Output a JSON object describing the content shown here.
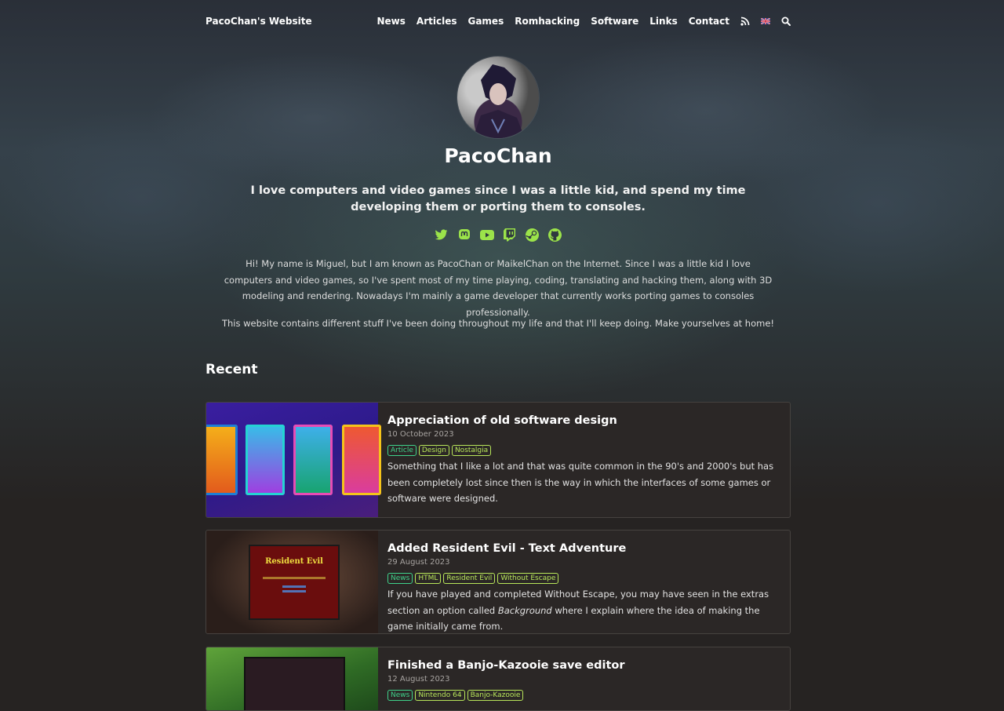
{
  "header": {
    "site_title": "PacoChan's Website",
    "menu": [
      "News",
      "Articles",
      "Games",
      "Romhacking",
      "Software",
      "Links",
      "Contact"
    ],
    "icons": [
      "rss-icon",
      "uk-flag-icon",
      "search-icon"
    ]
  },
  "hero": {
    "name": "PacoChan",
    "tagline": "I love computers and video games since I was a little kid, and spend my time developing them or porting them to consoles.",
    "socials": [
      "twitter-icon",
      "mastodon-icon",
      "youtube-icon",
      "twitch-icon",
      "steam-icon",
      "github-icon"
    ],
    "intro": "Hi! My name is Miguel, but I am known as PacoChan or MaikelChan on the Internet. Since I was a little kid I love computers and video games, so I've spent most of my time playing, coding, translating and hacking them, along with 3D modeling and rendering. Nowadays I'm mainly a game developer that currently works porting games to consoles professionally.",
    "intro2": "This website contains different stuff I've been doing throughout my life and that I'll keep doing. Make yourselves at home!"
  },
  "recent": {
    "heading": "Recent",
    "posts": [
      {
        "title": "Appreciation of old software design",
        "date": "10 October 2023",
        "tags": [
          "Article",
          "Design",
          "Nostalgia"
        ],
        "desc": "Something that I like a lot and that was quite common in the 90's and 2000's but has been completely lost since then is the way in which the interfaces of some games or software were designed."
      },
      {
        "title": "Added Resident Evil - Text Adventure",
        "date": "29 August 2023",
        "tags": [
          "News",
          "HTML",
          "Resident Evil",
          "Without Escape"
        ],
        "desc_before": "If you have played and completed Without Escape, you may have seen in the extras section an option called ",
        "desc_em": "Background",
        "desc_after": " where I explain where the idea of making the game initially came from.",
        "thumb_title": "Resident Evil"
      },
      {
        "title": "Finished a Banjo-Kazooie save editor",
        "date": "12 August 2023",
        "tags": [
          "News",
          "Nintendo 64",
          "Banjo-Kazooie"
        ]
      }
    ]
  },
  "colors": {
    "tag_green": "#3fd28b",
    "tag_lime": "#b8e65a",
    "social_green": "#9be34a",
    "page_bg": "#262322"
  }
}
